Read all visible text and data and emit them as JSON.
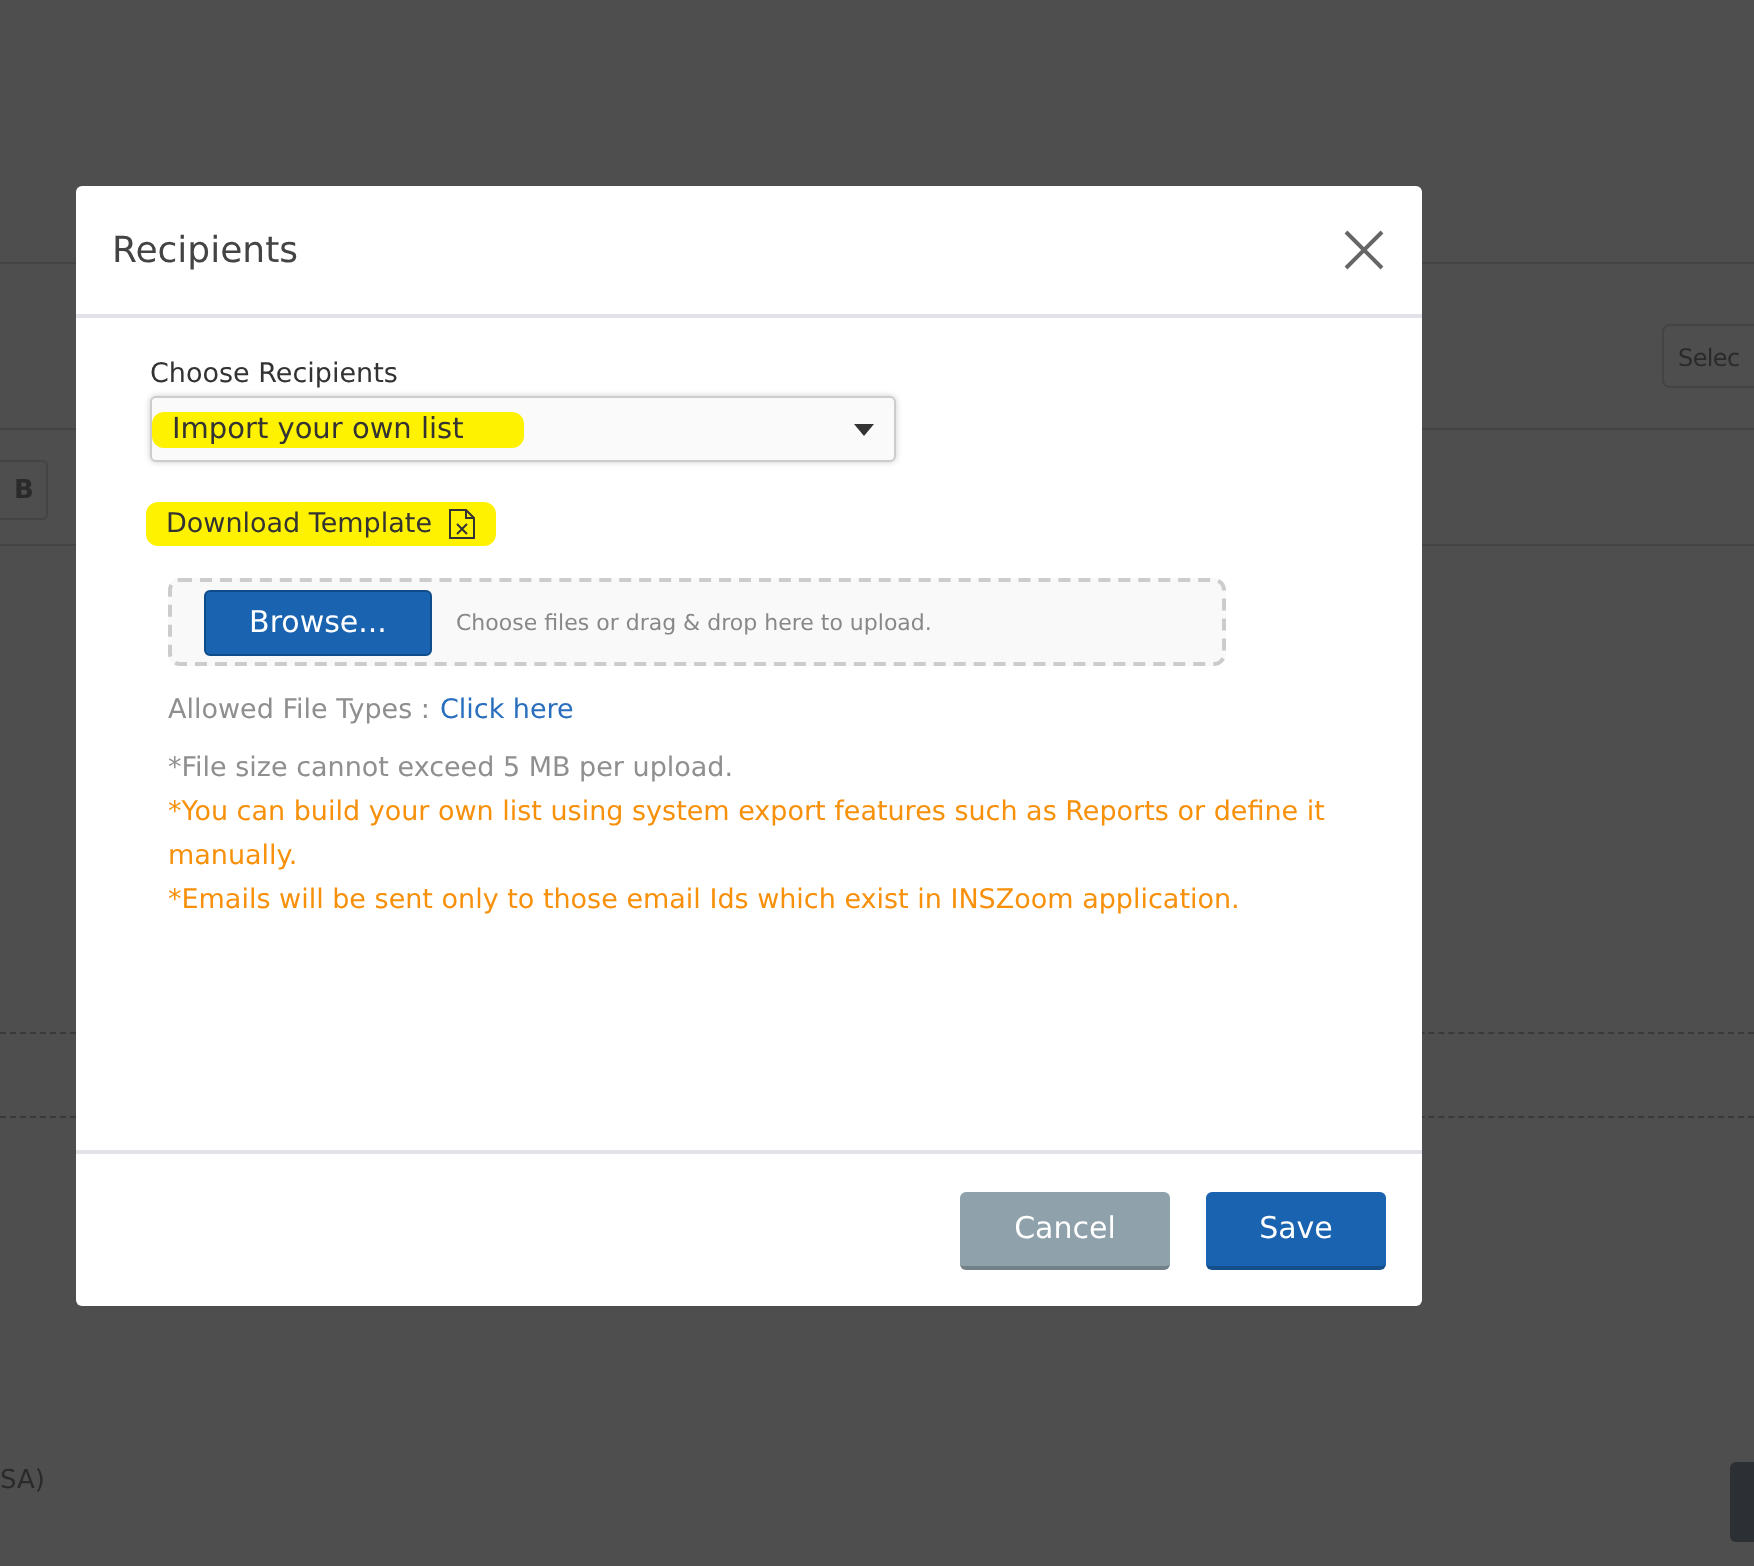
{
  "background": {
    "select_text": "Selec",
    "bold_button": "B",
    "footer_text": "SA)"
  },
  "dialog": {
    "title": "Recipients",
    "field_label": "Choose Recipients",
    "select": {
      "value": "Import your own list",
      "highlighted": true
    },
    "download_template": {
      "label": "Download Template",
      "highlighted": true
    },
    "upload": {
      "button": "Browse...",
      "hint": "Choose files or drag & drop here to upload."
    },
    "allowed_types": {
      "label": "Allowed File Types :",
      "link": "Click here"
    },
    "notes": [
      {
        "text": "*File size cannot exceed 5 MB per upload.",
        "kind": "info"
      },
      {
        "text": "*You can build your own list using system export features such as Reports or define it manually.",
        "kind": "warning"
      },
      {
        "text": "*Emails will be sent only to those email Ids which exist in INSZoom application.",
        "kind": "warning"
      }
    ],
    "buttons": [
      {
        "label": "Cancel",
        "kind": "secondary"
      },
      {
        "label": "Save",
        "kind": "primary"
      }
    ]
  }
}
